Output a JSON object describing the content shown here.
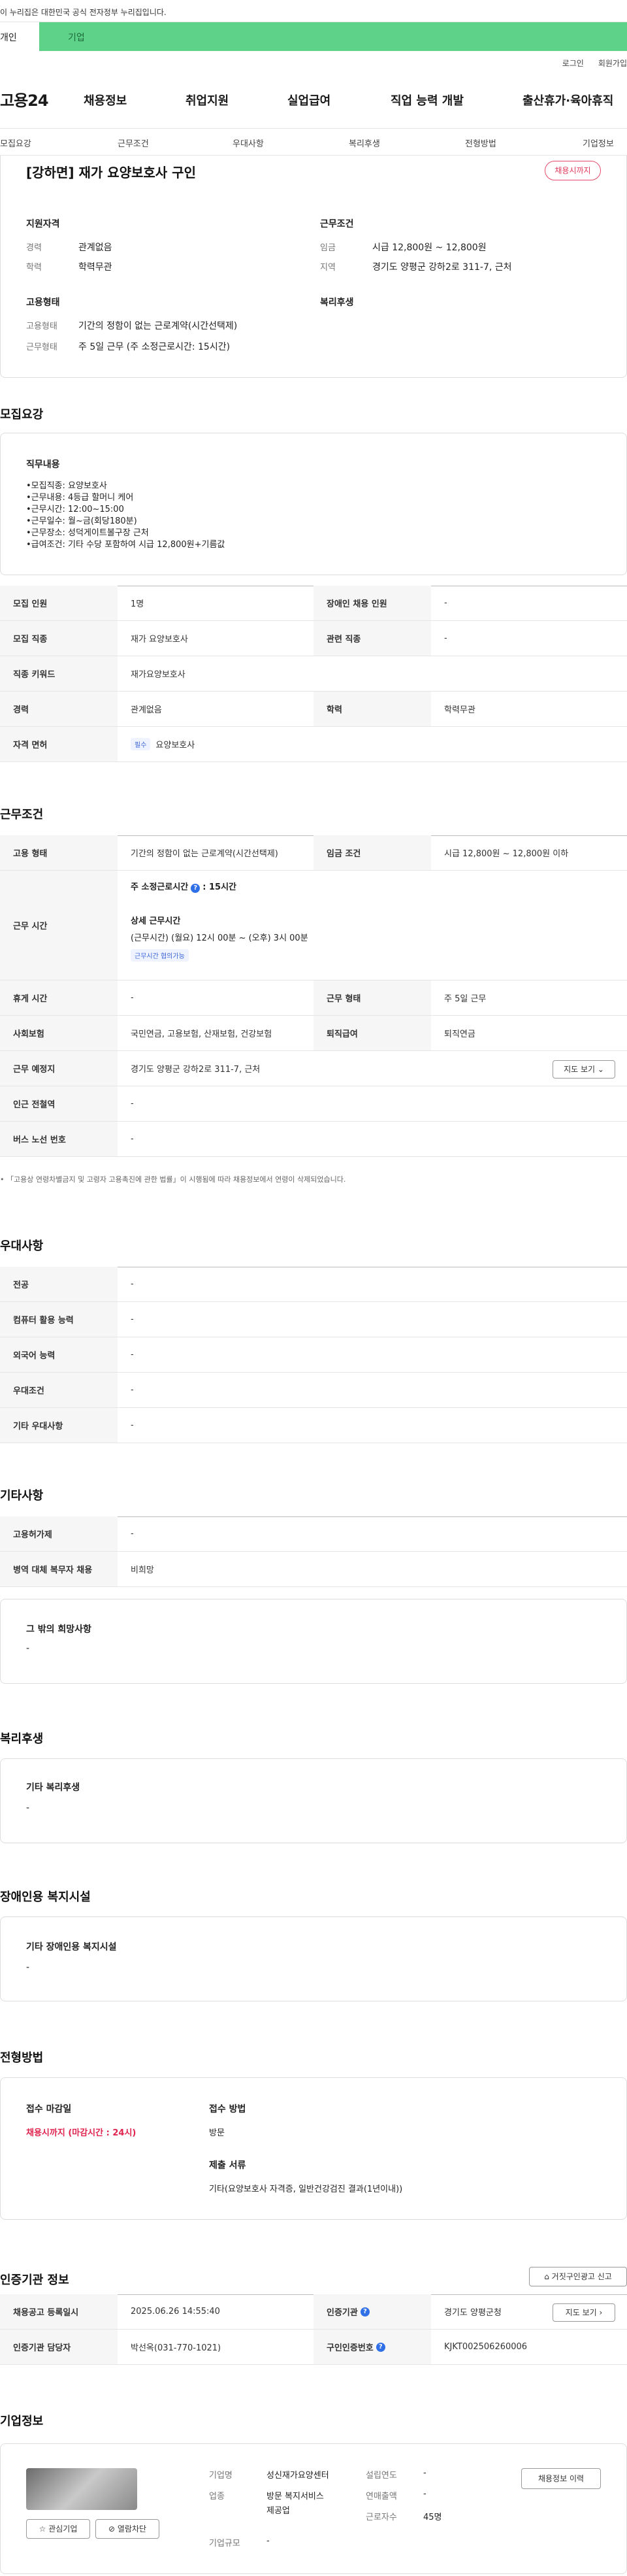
{
  "topbar": {
    "notice": "이 누리집은 대한민국 공식 전자정부 누리집입니다."
  },
  "catbar": {
    "individual": "개인",
    "company": "기업"
  },
  "utility": {
    "login": "로그인",
    "join": "회원가입"
  },
  "header": {
    "logo": "고용24",
    "gnb": [
      "채용정보",
      "취업지원",
      "실업급여",
      "직업 능력 개발",
      "출산휴가·육아휴직"
    ]
  },
  "subtabs": [
    "모집요강",
    "근무조건",
    "우대사항",
    "복리후생",
    "전형방법",
    "기업정보"
  ],
  "summary": {
    "title": "[강하면] 재가 요양보호사 구인",
    "badge": "채용시까지",
    "qual_h": "지원자격",
    "career_l": "경력",
    "career_v": "관계없음",
    "edu_l": "학력",
    "edu_v": "학력무관",
    "emp_h": "고용형태",
    "emp_l": "고용형태",
    "emp_v": "기간의 정함이 없는 근로계약(시간선택제)",
    "work_l": "근무형태",
    "work_v": "주 5일 근무 (주 소정근로시간: 15시간)",
    "cond_h": "근무조건",
    "wage_l": "임금",
    "wage_v": "시급 12,800원 ~ 12,800원",
    "area_l": "지역",
    "area_v": "경기도 양평군 강하2로 311-7, 근처",
    "welfare_h": "복리후생"
  },
  "recruit": {
    "title": "모집요강",
    "duty_h": "직무내용",
    "duty_lines": [
      "•모집직종: 요양보호사",
      "•근무내용: 4등급 할머니 케어",
      "•근무시간: 12:00~15:00",
      "•근무일수: 월~금(회당180분)",
      "•근무장소: 성덕게이트볼구장 근처",
      "•급여조건: 기타 수당 포함하여 시급 12,800원+기름값"
    ],
    "rows": [
      {
        "l1": "모집 인원",
        "v1": "1명",
        "l2": "장애인 채용 인원",
        "v2": "-"
      },
      {
        "l1": "모집 직종",
        "v1": "재가 요양보호사",
        "l2": "관련 직종",
        "v2": "-"
      },
      {
        "l1": "직종 키워드",
        "v1": "재가요양보호사"
      },
      {
        "l1": "경력",
        "v1": "관계없음",
        "l2": "학력",
        "v2": "학력무관"
      },
      {
        "l1": "자격 면허",
        "tag": "필수",
        "v1": "요양보호사"
      }
    ]
  },
  "condition": {
    "title": "근무조건",
    "emp_l": "고용 형태",
    "emp_v": "기간의 정함이 없는 근로계약(시간선택제)",
    "wage_l": "임금 조건",
    "wage_v": "시급 12,800원 ~ 12,800원 이하",
    "time_l": "근무 시간",
    "weekly": "주 소정근로시간",
    "weekly_v": ": 15시간",
    "detail_h": "상세 근무시간",
    "detail_v": "(근무시간) (월요) 12시 00분 ~ (오후) 3시 00분",
    "detail_tag": "근무시간 협의가능",
    "rest_l": "휴게 시간",
    "rest_v": "-",
    "form_l": "근무 형태",
    "form_v": "주 5일 근무",
    "ins_l": "사회보험",
    "ins_v": "국민연금, 고용보험, 산재보험, 건강보험",
    "ret_l": "퇴직급여",
    "ret_v": "퇴직연금",
    "place_l": "근무 예정지",
    "place_v": "경기도 양평군 강하2로 311-7, 근처",
    "map_btn": "지도 보기",
    "sub_l": "인근 전철역",
    "sub_v": "-",
    "bus_l": "버스 노선 번호",
    "bus_v": "-",
    "note": "「고용상 연령차별금지 및 고령자 고용촉진에 관한 법률」이 시행됨에 따라 채용정보에서 연령이 삭제되었습니다."
  },
  "pref": {
    "title": "우대사항",
    "rows": [
      {
        "l": "전공",
        "v": "-"
      },
      {
        "l": "컴퓨터 활용 능력",
        "v": "-"
      },
      {
        "l": "외국어 능력",
        "v": "-"
      },
      {
        "l": "우대조건",
        "v": "-"
      },
      {
        "l": "기타 우대사항",
        "v": "-"
      }
    ]
  },
  "etc": {
    "title": "기타사항",
    "rows": [
      {
        "l": "고용허가제",
        "v": "-"
      },
      {
        "l": "병역 대체 복무자 채용",
        "v": "비희망"
      }
    ],
    "other_h": "그 밖의 희망사항",
    "other_v": "-"
  },
  "welfare": {
    "title": "복리후생",
    "h": "기타 복리후생",
    "v": "-"
  },
  "disabled": {
    "title": "장애인용 복지시설",
    "h": "기타 장애인용 복지시설",
    "v": "-"
  },
  "selection": {
    "title": "전형방법",
    "deadline_h": "접수 마감일",
    "deadline_v": "채용시까지 (마감시간 : 24시)",
    "method_h": "접수 방법",
    "method_v": "방문",
    "docs_h": "제출 서류",
    "docs_v": "기타(요양보호사 자격증, 일반건강검진 결과(1년이내))"
  },
  "agency": {
    "title": "인증기관 정보",
    "report_btn": "거짓구인광고 신고",
    "reg_l": "채용공고 등록일시",
    "reg_v": "2025.06.26 14:55:40",
    "org_l": "인증기관",
    "org_v": "경기도 양평군청",
    "map_btn": "지도 보기",
    "mgr_l": "인증기관 담당자",
    "mgr_v": "박선옥(031-770-1021)",
    "no_l": "구인인증번호",
    "no_v": "KJKT002506260006"
  },
  "company": {
    "title": "기업정보",
    "interest_btn": "관심기업",
    "block_btn": "열람차단",
    "name_l": "기업명",
    "name_v": "성신재가요양센터",
    "year_l": "설립연도",
    "year_v": "-",
    "biz_l": "업종",
    "biz_v1": "방문 복지서비스",
    "biz_v2": "제공업",
    "sales_l": "연매출액",
    "sales_v": "-",
    "emp_l": "근로자수",
    "emp_v": "45명",
    "size_l": "기업규모",
    "size_v": "-",
    "history_btn": "채용정보 이력"
  }
}
